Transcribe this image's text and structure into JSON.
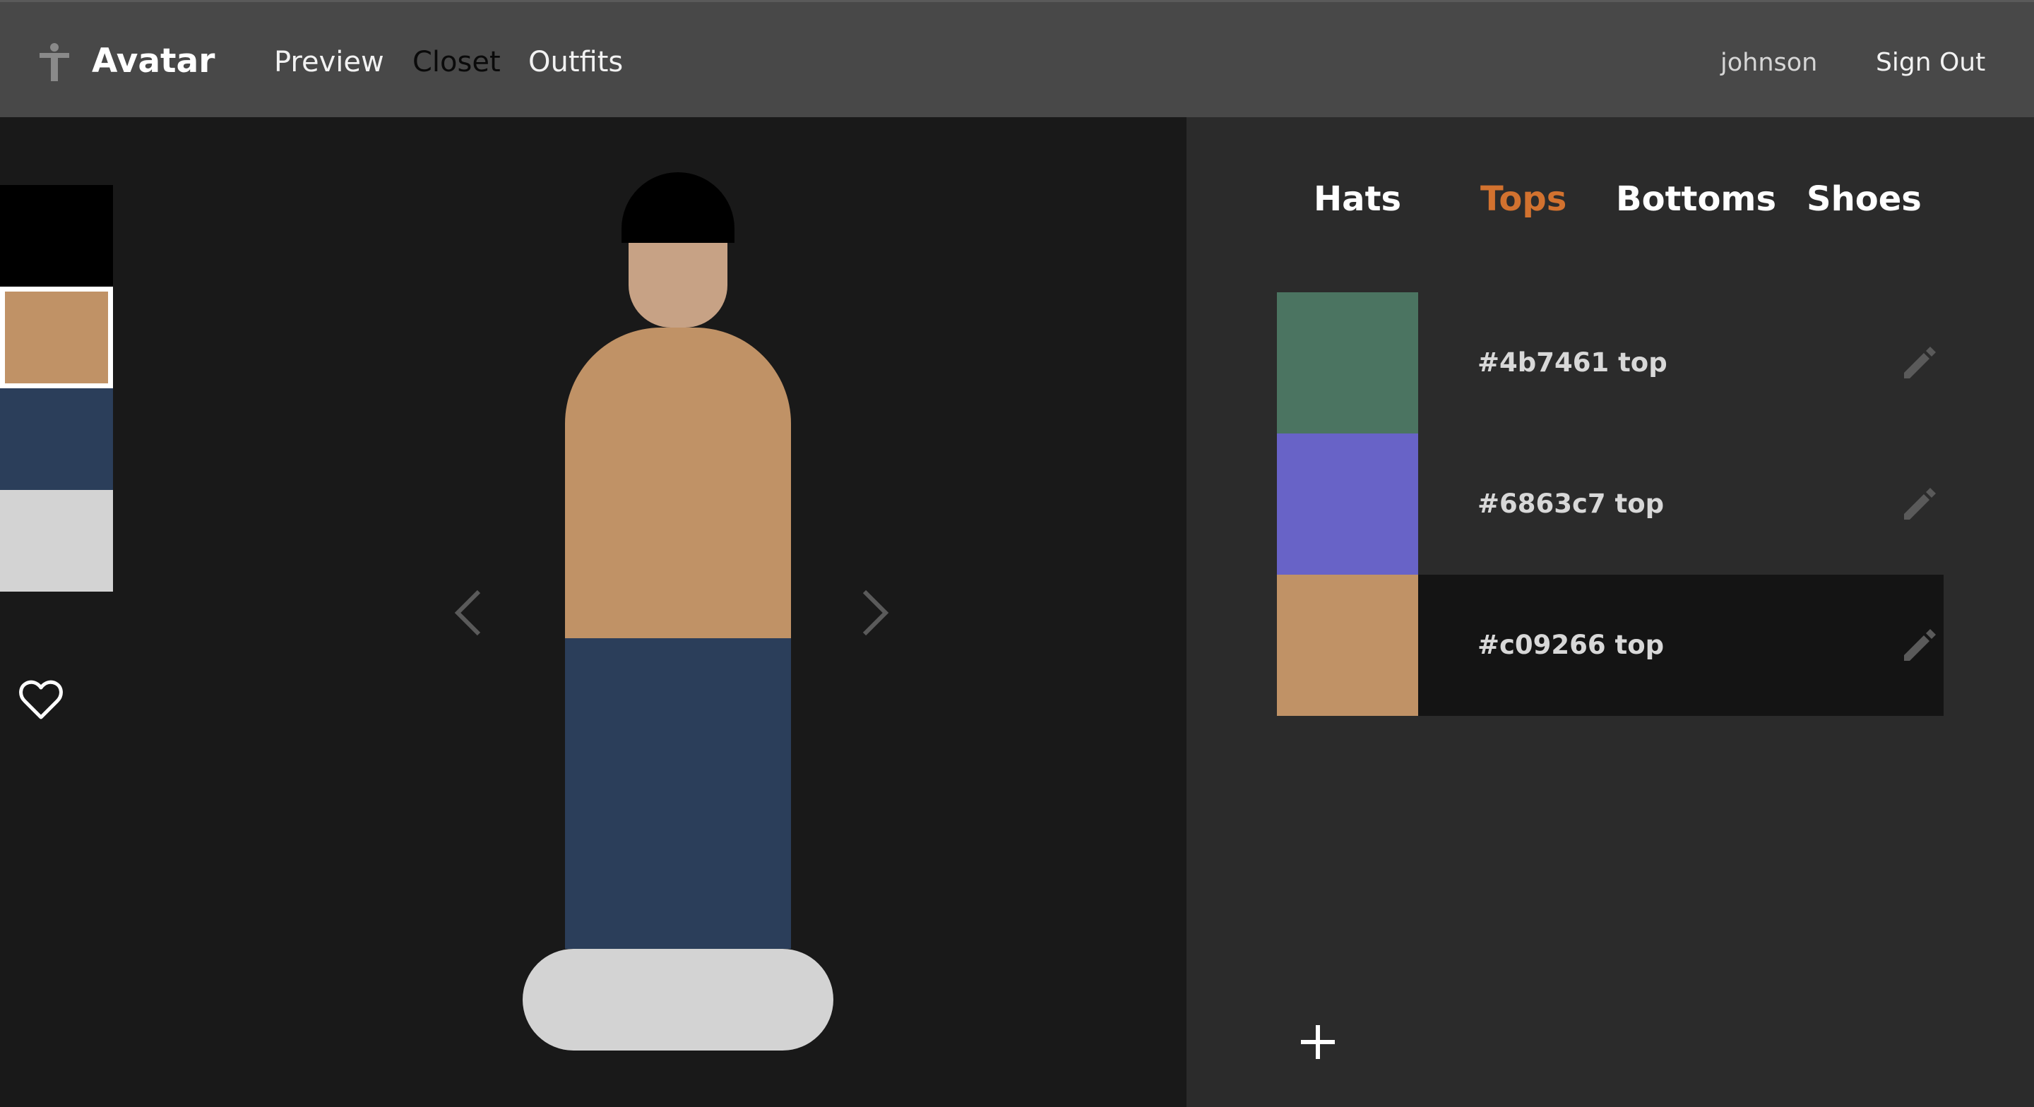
{
  "header": {
    "brand_icon": "accessibility-person-icon",
    "brand_name": "Avatar",
    "nav": {
      "preview": "Preview",
      "closet": "Closet",
      "outfits": "Outfits"
    },
    "username": "johnson",
    "sign_out": "Sign Out"
  },
  "preview": {
    "outfit_swatches": [
      {
        "slot": "hat",
        "color": "#000000"
      },
      {
        "slot": "top",
        "color": "#c09266",
        "selected": true
      },
      {
        "slot": "bottoms",
        "color": "#2b3e5a"
      },
      {
        "slot": "shoes",
        "color": "#d3d3d3"
      }
    ],
    "favorite_icon": "heart-outline-icon",
    "prev_icon": "chevron-left-icon",
    "next_icon": "chevron-right-icon",
    "avatar": {
      "hat_color": "#000000",
      "skin_color": "#c7a285",
      "top_color": "#c09266",
      "bottoms_color": "#2b3e5a",
      "shoes_color": "#d3d3d3"
    }
  },
  "closet": {
    "tabs": [
      {
        "label": "Hats",
        "active": false
      },
      {
        "label": "Tops",
        "active": true
      },
      {
        "label": "Bottoms",
        "active": false
      },
      {
        "label": "Shoes",
        "active": false
      }
    ],
    "active_tab_color": "#d2722f",
    "items": [
      {
        "color": "#4b7461",
        "label": "#4b7461 top",
        "selected": false
      },
      {
        "color": "#6863c7",
        "label": "#6863c7 top",
        "selected": false
      },
      {
        "color": "#c09266",
        "label": "#c09266 top",
        "selected": true
      }
    ],
    "edit_icon": "pencil-icon",
    "add_icon": "plus-icon"
  }
}
